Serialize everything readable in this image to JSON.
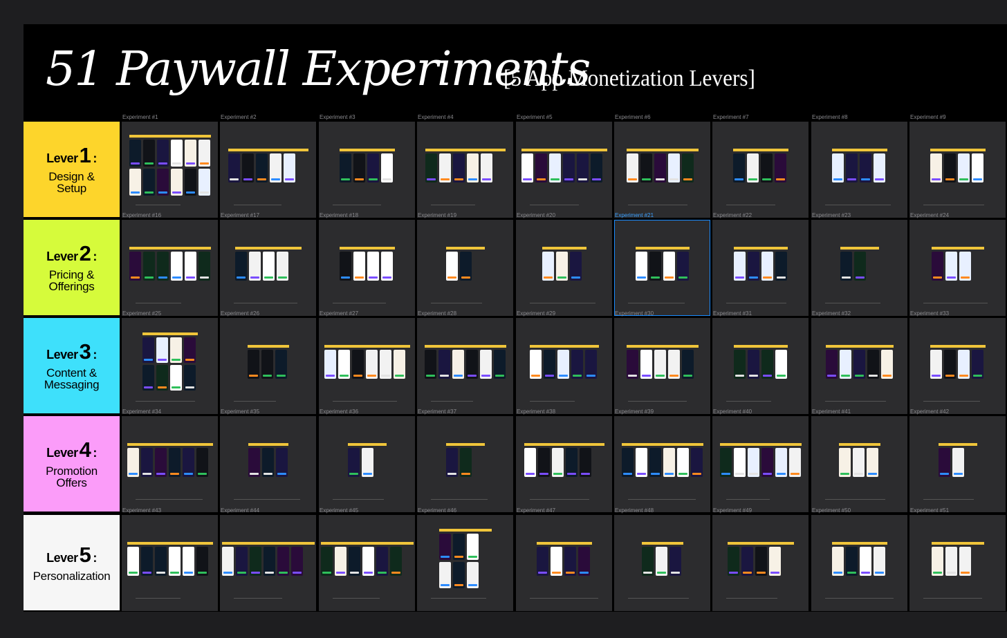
{
  "title": "51 Paywall Experiments",
  "subtitle": "[5 App Monetization Levers]",
  "levers": [
    {
      "word": "Lever",
      "num": "1",
      "colon": ":",
      "sub": "Design &\nSetup",
      "color": "#fdd52b"
    },
    {
      "word": "Lever",
      "num": "2",
      "colon": ":",
      "sub": "Pricing &\nOfferings",
      "color": "#d6fb3b"
    },
    {
      "word": "Lever",
      "num": "3",
      "colon": ":",
      "sub": "Content &\nMessaging",
      "color": "#3ee0fb"
    },
    {
      "word": "Lever",
      "num": "4",
      "colon": ":",
      "sub": "Promotion\nOffers",
      "color": "#fb9cf9"
    },
    {
      "word": "Lever",
      "num": "5",
      "colon": ":",
      "sub": "Personalization",
      "color": "#f6f6f6"
    }
  ],
  "experiments": [
    "Experiment #1",
    "Experiment #2",
    "Experiment #3",
    "Experiment #4",
    "Experiment #5",
    "Experiment #6",
    "Experiment #7",
    "Experiment #8",
    "Experiment #9",
    "Experiment #16",
    "Experiment #17",
    "Experiment #18",
    "Experiment #19",
    "Experiment #20",
    "Experiment #21",
    "Experiment #22",
    "Experiment #23",
    "Experiment #24",
    "Experiment #25",
    "Experiment #26",
    "Experiment #27",
    "Experiment #28",
    "Experiment #29",
    "Experiment #30",
    "Experiment #31",
    "Experiment #32",
    "Experiment #33",
    "Experiment #34",
    "Experiment #35",
    "Experiment #36",
    "Experiment #37",
    "Experiment #38",
    "Experiment #39",
    "Experiment #40",
    "Experiment #41",
    "Experiment #42",
    "Experiment #43",
    "Experiment #44",
    "Experiment #45",
    "Experiment #46",
    "Experiment #47",
    "Experiment #48",
    "Experiment #49",
    "Experiment #50",
    "Experiment #51"
  ],
  "selected_experiment": "Experiment #21",
  "colors": {
    "canvas": "#1e1e20",
    "cell": "#2c2c2e",
    "selection": "#1a8cff",
    "thumb_header": "#f0c53a"
  }
}
